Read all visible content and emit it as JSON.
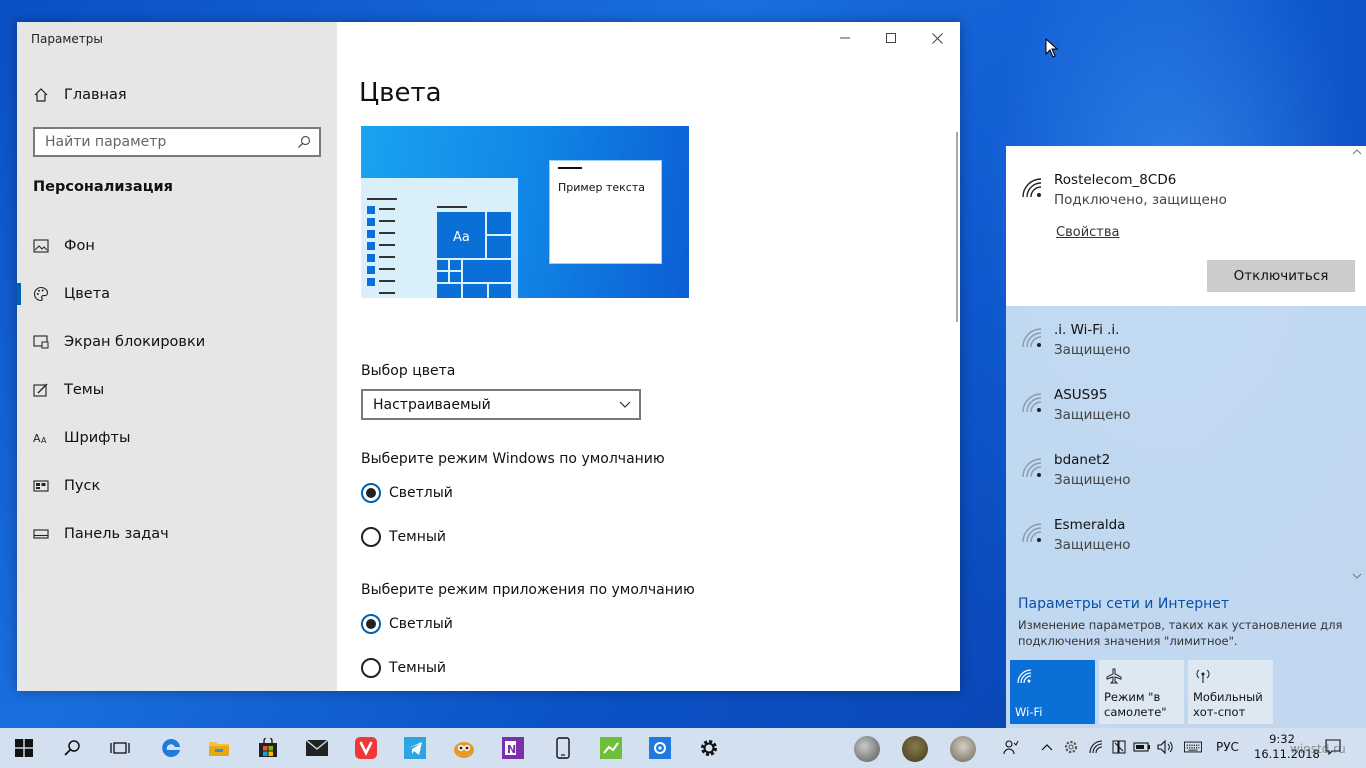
{
  "window": {
    "app_title": "Параметры",
    "home_label": "Главная",
    "search_placeholder": "Найти параметр",
    "section": "Персонализация",
    "nav_items": [
      {
        "label": "Фон"
      },
      {
        "label": "Цвета",
        "active": true
      },
      {
        "label": "Экран блокировки"
      },
      {
        "label": "Темы"
      },
      {
        "label": "Шрифты"
      },
      {
        "label": "Пуск"
      },
      {
        "label": "Панель задач"
      }
    ]
  },
  "content": {
    "title": "Цвета",
    "preview_sample_text": "Пример текста",
    "preview_tile_text": "Aa",
    "color_choice_label": "Выбор цвета",
    "color_choice_value": "Настраиваемый",
    "windows_mode_label": "Выберите режим Windows по умолчанию",
    "windows_mode_options": [
      "Светлый",
      "Темный"
    ],
    "windows_mode_selected": "Светлый",
    "app_mode_label": "Выберите режим приложения по умолчанию",
    "app_mode_options": [
      "Светлый",
      "Темный"
    ],
    "app_mode_selected": "Светлый"
  },
  "network_flyout": {
    "connected": {
      "name": "Rostelecom_8CD6",
      "status": "Подключено, защищено",
      "properties_link": "Свойства",
      "disconnect_label": "Отключиться"
    },
    "networks": [
      {
        "name": ".i. Wi-Fi .i.",
        "status": "Защищено"
      },
      {
        "name": "ASUS95",
        "status": "Защищено"
      },
      {
        "name": "bdanet2",
        "status": "Защищено"
      },
      {
        "name": "Esmeralda",
        "status": "Защищено"
      }
    ],
    "settings_link": "Параметры сети и Интернет",
    "settings_desc": "Изменение параметров, таких как установление для подключения значения \"лимитное\".",
    "tiles": [
      {
        "label": "Wi-Fi",
        "on": true
      },
      {
        "label": "Режим \"в самолете\"",
        "on": false
      },
      {
        "label": "Мобильный хот-спот",
        "on": false
      }
    ]
  },
  "taskbar": {
    "language": "РУС",
    "time": "9:32",
    "date": "16.11.2018",
    "watermark": "winstd.ru"
  },
  "colors": {
    "accent": "#0063b1",
    "taskbar_bg": "#d3e0ef",
    "wifi_tile_on": "#0a6fd6"
  }
}
